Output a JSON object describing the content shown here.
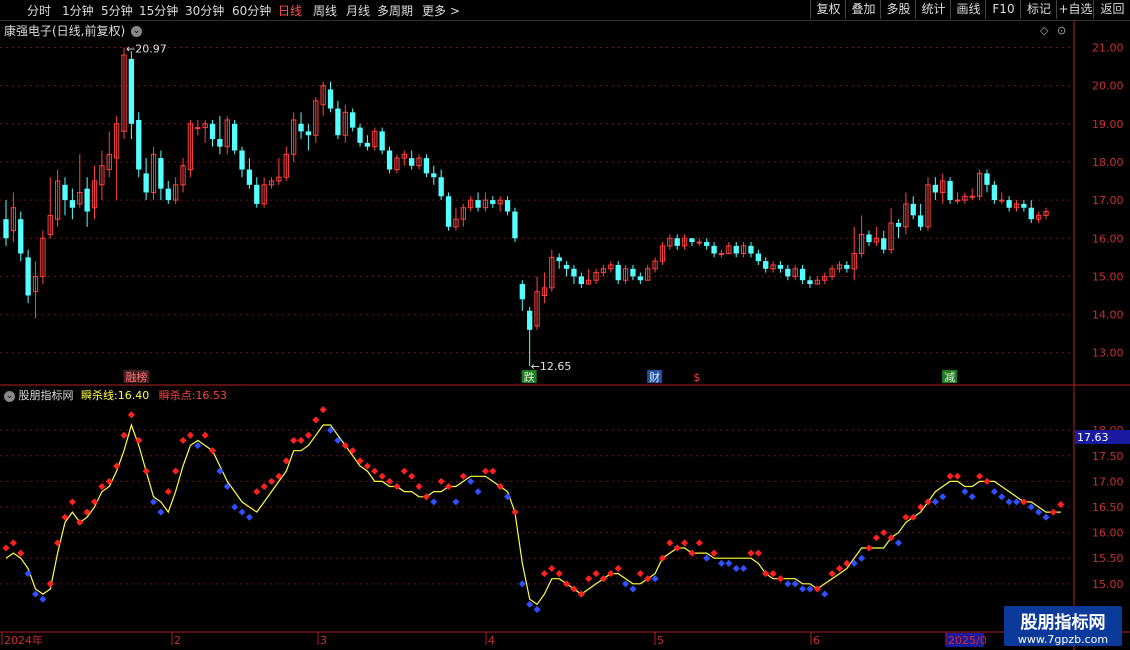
{
  "toolbar": {
    "periods": [
      "分时",
      "1分钟",
      "5分钟",
      "15分钟",
      "30分钟",
      "60分钟",
      "日线",
      "周线",
      "月线",
      "多周期",
      "更多 >"
    ],
    "active": "日线",
    "buttons": [
      "复权",
      "叠加",
      "多股",
      "统计",
      "画线",
      "F10",
      "标记",
      "+自选",
      "返回"
    ]
  },
  "price_panel": {
    "title": "康强电子(日线,前复权)"
  },
  "indicator_panel": {
    "name": "股朋指标网",
    "line_label": "瞬杀线:",
    "line_value": "16.40",
    "point_label": "瞬杀点:",
    "point_value": "16.53",
    "current_tag": "17.63"
  },
  "event_tags": [
    {
      "text": "融榜",
      "color": "#ff7070"
    },
    {
      "text": "跌",
      "color": "#e8e8e8"
    },
    {
      "text": "财",
      "color": "#e8e8e8"
    },
    {
      "text": "$",
      "color": "#ff4040"
    },
    {
      "text": "减",
      "color": "#e8e8e8"
    }
  ],
  "x_axis": {
    "labels": [
      "2024年",
      "2",
      "3",
      "4",
      "5",
      "6",
      "2025/0"
    ]
  },
  "watermark": {
    "title": "股朋指标网",
    "url": "www.7gpzb.com"
  },
  "colors": {
    "up": "#ff4040",
    "down": "#54ffff",
    "line": "#ffff40",
    "red_dot": "#ff2020",
    "blue_dot": "#3050ff"
  },
  "chart_data": [
    {
      "type": "candlestick",
      "title": "康强电子(日线,前复权)",
      "ylim": [
        12.6,
        21.3
      ],
      "y_ticks": [
        13.0,
        14.0,
        15.0,
        16.0,
        17.0,
        18.0,
        19.0,
        20.0,
        21.0
      ],
      "annotations": [
        {
          "text": "20.97",
          "value": 20.97
        },
        {
          "text": "12.65",
          "value": 12.65
        }
      ],
      "candles": [
        [
          16.5,
          16.0,
          17.0,
          15.8
        ],
        [
          16.2,
          16.8,
          17.2,
          15.9
        ],
        [
          16.5,
          15.6,
          16.7,
          15.4
        ],
        [
          15.5,
          14.5,
          15.7,
          14.3
        ],
        [
          14.6,
          15.0,
          15.4,
          13.9
        ],
        [
          15.0,
          16.0,
          16.2,
          14.8
        ],
        [
          16.1,
          16.6,
          17.6,
          16.0
        ],
        [
          16.5,
          17.5,
          17.8,
          16.3
        ],
        [
          17.4,
          17.0,
          17.6,
          16.6
        ],
        [
          17.0,
          16.8,
          17.3,
          16.5
        ],
        [
          16.9,
          17.2,
          18.2,
          16.8
        ],
        [
          17.3,
          16.7,
          17.6,
          16.3
        ],
        [
          16.8,
          17.5,
          17.9,
          16.5
        ],
        [
          17.4,
          17.9,
          18.3,
          17.0
        ],
        [
          17.8,
          18.2,
          18.8,
          17.6
        ],
        [
          18.1,
          19.0,
          19.2,
          17.0
        ],
        [
          18.8,
          20.8,
          21.0,
          18.6
        ],
        [
          20.7,
          19.0,
          20.9,
          18.6
        ],
        [
          19.1,
          17.8,
          19.3,
          17.6
        ],
        [
          17.7,
          17.2,
          18.1,
          17.0
        ],
        [
          17.2,
          18.2,
          18.4,
          17.0
        ],
        [
          18.1,
          17.3,
          18.3,
          17.0
        ],
        [
          17.3,
          17.0,
          17.5,
          16.9
        ],
        [
          17.0,
          17.4,
          17.6,
          16.9
        ],
        [
          17.4,
          17.9,
          18.1,
          17.2
        ],
        [
          17.8,
          19.0,
          19.1,
          17.6
        ],
        [
          18.9,
          18.9,
          19.1,
          18.7
        ],
        [
          18.9,
          19.0,
          19.1,
          18.5
        ],
        [
          19.0,
          18.6,
          19.1,
          18.4
        ],
        [
          18.6,
          18.4,
          19.2,
          18.2
        ],
        [
          18.4,
          19.1,
          19.2,
          18.2
        ],
        [
          19.0,
          18.3,
          19.1,
          18.2
        ],
        [
          18.3,
          17.8,
          18.4,
          17.6
        ],
        [
          17.8,
          17.4,
          18.1,
          17.3
        ],
        [
          17.4,
          16.9,
          17.6,
          16.8
        ],
        [
          16.9,
          17.4,
          17.6,
          16.8
        ],
        [
          17.4,
          17.5,
          17.6,
          17.3
        ],
        [
          17.5,
          17.6,
          18.1,
          17.4
        ],
        [
          17.6,
          18.2,
          18.4,
          17.5
        ],
        [
          18.2,
          19.1,
          19.3,
          18.0
        ],
        [
          19.0,
          18.8,
          19.3,
          18.6
        ],
        [
          18.8,
          18.7,
          19.0,
          18.3
        ],
        [
          18.7,
          19.6,
          19.7,
          18.5
        ],
        [
          19.5,
          20.0,
          20.1,
          19.2
        ],
        [
          19.9,
          19.4,
          20.1,
          19.3
        ],
        [
          19.4,
          18.7,
          19.6,
          18.6
        ],
        [
          18.7,
          19.3,
          19.5,
          18.5
        ],
        [
          19.3,
          18.9,
          19.4,
          18.8
        ],
        [
          18.9,
          18.5,
          19.0,
          18.4
        ],
        [
          18.5,
          18.4,
          18.7,
          18.3
        ],
        [
          18.4,
          18.8,
          18.9,
          18.3
        ],
        [
          18.8,
          18.3,
          18.9,
          18.2
        ],
        [
          18.3,
          17.8,
          18.4,
          17.7
        ],
        [
          17.8,
          18.1,
          18.2,
          17.7
        ],
        [
          18.1,
          18.2,
          18.3,
          17.9
        ],
        [
          18.1,
          17.9,
          18.3,
          17.8
        ],
        [
          17.9,
          18.1,
          18.2,
          17.8
        ],
        [
          18.1,
          17.7,
          18.2,
          17.6
        ],
        [
          17.7,
          17.6,
          17.9,
          17.4
        ],
        [
          17.6,
          17.1,
          17.8,
          17.0
        ],
        [
          17.1,
          16.3,
          17.2,
          16.2
        ],
        [
          16.3,
          16.5,
          16.8,
          16.2
        ],
        [
          16.5,
          16.8,
          16.9,
          16.3
        ],
        [
          16.8,
          17.0,
          17.1,
          16.7
        ],
        [
          17.0,
          16.8,
          17.2,
          16.7
        ],
        [
          16.8,
          17.0,
          17.2,
          16.7
        ],
        [
          17.0,
          16.9,
          17.1,
          16.8
        ],
        [
          16.9,
          17.0,
          17.1,
          16.7
        ],
        [
          17.0,
          16.7,
          17.1,
          16.6
        ],
        [
          16.7,
          16.0,
          16.8,
          15.9
        ],
        [
          14.8,
          14.4,
          14.9,
          14.1
        ],
        [
          14.1,
          13.6,
          14.2,
          12.65
        ],
        [
          13.7,
          14.6,
          15.0,
          13.6
        ],
        [
          14.5,
          14.7,
          15.1,
          14.3
        ],
        [
          14.7,
          15.5,
          15.7,
          14.6
        ],
        [
          15.5,
          15.4,
          15.6,
          15.2
        ],
        [
          15.3,
          15.2,
          15.4,
          15.0
        ],
        [
          15.2,
          15.0,
          15.3,
          14.8
        ],
        [
          15.0,
          14.8,
          15.1,
          14.7
        ],
        [
          14.8,
          14.9,
          15.2,
          14.8
        ],
        [
          14.9,
          15.1,
          15.2,
          14.8
        ],
        [
          15.1,
          15.2,
          15.3,
          15.0
        ],
        [
          15.2,
          15.3,
          15.4,
          15.1
        ],
        [
          15.3,
          14.9,
          15.4,
          14.8
        ],
        [
          14.9,
          15.2,
          15.3,
          14.8
        ],
        [
          15.2,
          15.0,
          15.3,
          14.9
        ],
        [
          15.0,
          14.9,
          15.1,
          14.8
        ],
        [
          14.9,
          15.2,
          15.3,
          14.9
        ],
        [
          15.2,
          15.4,
          15.5,
          15.1
        ],
        [
          15.4,
          15.8,
          15.9,
          15.3
        ],
        [
          15.8,
          16.0,
          16.1,
          15.7
        ],
        [
          16.0,
          15.8,
          16.1,
          15.7
        ],
        [
          15.8,
          16.0,
          16.1,
          15.7
        ],
        [
          16.0,
          15.9,
          16.0,
          15.8
        ],
        [
          15.9,
          15.9,
          16.0,
          15.8
        ],
        [
          15.9,
          15.8,
          16.0,
          15.7
        ],
        [
          15.8,
          15.6,
          15.9,
          15.5
        ],
        [
          15.6,
          15.6,
          15.7,
          15.5
        ],
        [
          15.6,
          15.8,
          15.9,
          15.6
        ],
        [
          15.8,
          15.6,
          15.9,
          15.5
        ],
        [
          15.6,
          15.8,
          15.9,
          15.5
        ],
        [
          15.8,
          15.6,
          15.9,
          15.5
        ],
        [
          15.6,
          15.4,
          15.7,
          15.3
        ],
        [
          15.4,
          15.2,
          15.5,
          15.1
        ],
        [
          15.2,
          15.3,
          15.4,
          15.1
        ],
        [
          15.3,
          15.2,
          15.4,
          15.1
        ],
        [
          15.2,
          15.0,
          15.3,
          14.9
        ],
        [
          15.0,
          15.2,
          15.3,
          14.9
        ],
        [
          15.2,
          14.9,
          15.3,
          14.8
        ],
        [
          14.9,
          14.8,
          15.0,
          14.7
        ],
        [
          14.8,
          14.9,
          15.0,
          14.8
        ],
        [
          14.9,
          15.0,
          15.1,
          14.8
        ],
        [
          15.0,
          15.2,
          15.3,
          14.9
        ],
        [
          15.2,
          15.3,
          15.4,
          15.1
        ],
        [
          15.3,
          15.2,
          15.4,
          15.1
        ],
        [
          15.2,
          15.6,
          16.3,
          14.9
        ],
        [
          15.6,
          16.1,
          16.6,
          15.5
        ],
        [
          16.1,
          15.9,
          16.2,
          15.8
        ],
        [
          15.9,
          16.0,
          16.3,
          15.8
        ],
        [
          16.0,
          15.7,
          16.2,
          15.6
        ],
        [
          15.7,
          16.4,
          16.8,
          15.6
        ],
        [
          16.4,
          16.3,
          16.5,
          16.0
        ],
        [
          16.3,
          16.9,
          17.2,
          16.1
        ],
        [
          16.9,
          16.6,
          17.1,
          16.5
        ],
        [
          16.6,
          16.3,
          16.9,
          16.2
        ],
        [
          16.3,
          17.4,
          17.6,
          16.2
        ],
        [
          17.4,
          17.2,
          17.6,
          17.0
        ],
        [
          17.2,
          17.5,
          17.7,
          16.9
        ],
        [
          17.5,
          17.0,
          17.6,
          16.9
        ],
        [
          17.0,
          17.0,
          17.2,
          16.9
        ],
        [
          17.0,
          17.1,
          17.2,
          16.9
        ],
        [
          17.1,
          17.1,
          17.3,
          17.0
        ],
        [
          17.1,
          17.7,
          17.8,
          17.0
        ],
        [
          17.7,
          17.4,
          17.8,
          17.2
        ],
        [
          17.4,
          17.0,
          17.5,
          16.9
        ],
        [
          17.0,
          17.0,
          17.2,
          16.9
        ],
        [
          17.0,
          16.8,
          17.1,
          16.7
        ],
        [
          16.8,
          16.9,
          17.0,
          16.7
        ],
        [
          16.9,
          16.8,
          17.0,
          16.7
        ],
        [
          16.8,
          16.5,
          17.0,
          16.4
        ],
        [
          16.5,
          16.6,
          16.7,
          16.4
        ],
        [
          16.6,
          16.7,
          16.8,
          16.5
        ]
      ]
    },
    {
      "type": "line",
      "title": "股朋指标网",
      "ylim": [
        14.45,
        18.55
      ],
      "y_ticks": [
        15.0,
        15.5,
        16.0,
        16.5,
        17.0,
        17.5,
        18.0
      ],
      "series": [
        {
          "name": "瞬杀线",
          "values": [
            15.5,
            15.6,
            15.5,
            15.3,
            14.9,
            14.8,
            14.9,
            15.6,
            16.2,
            16.4,
            16.2,
            16.3,
            16.5,
            16.8,
            16.9,
            17.2,
            17.6,
            18.1,
            17.7,
            17.2,
            16.7,
            16.6,
            16.4,
            16.8,
            17.3,
            17.7,
            17.8,
            17.7,
            17.6,
            17.3,
            17.0,
            16.8,
            16.6,
            16.5,
            16.4,
            16.6,
            16.8,
            17.0,
            17.2,
            17.6,
            17.6,
            17.7,
            17.9,
            18.1,
            18.1,
            17.9,
            17.7,
            17.5,
            17.3,
            17.2,
            17.0,
            17.0,
            16.9,
            16.9,
            16.8,
            16.8,
            16.7,
            16.7,
            16.8,
            16.8,
            16.9,
            16.9,
            17.0,
            17.1,
            17.1,
            17.1,
            17.0,
            16.9,
            16.8,
            16.4,
            15.4,
            14.7,
            14.6,
            14.8,
            15.1,
            15.1,
            15.0,
            14.9,
            14.8,
            14.9,
            15.0,
            15.1,
            15.2,
            15.2,
            15.1,
            15.0,
            15.0,
            15.1,
            15.2,
            15.5,
            15.6,
            15.7,
            15.7,
            15.6,
            15.6,
            15.6,
            15.5,
            15.5,
            15.5,
            15.5,
            15.5,
            15.5,
            15.4,
            15.2,
            15.1,
            15.1,
            15.1,
            15.1,
            15.0,
            15.0,
            14.9,
            15.0,
            15.1,
            15.2,
            15.3,
            15.5,
            15.7,
            15.7,
            15.7,
            15.7,
            15.9,
            16.0,
            16.2,
            16.3,
            16.4,
            16.6,
            16.8,
            16.9,
            17.0,
            17.0,
            16.9,
            16.9,
            17.0,
            17.0,
            17.0,
            16.9,
            16.8,
            16.7,
            16.6,
            16.6,
            16.5,
            16.4,
            16.4,
            16.4
          ]
        },
        {
          "name": "瞬杀点",
          "values": [
            15.7,
            15.8,
            15.6,
            15.2,
            14.8,
            14.7,
            15.0,
            15.8,
            16.3,
            16.6,
            16.2,
            16.4,
            16.6,
            16.9,
            17.0,
            17.3,
            17.9,
            18.3,
            17.8,
            17.2,
            16.6,
            16.4,
            16.8,
            17.2,
            17.8,
            17.9,
            17.7,
            17.9,
            17.6,
            17.2,
            16.9,
            16.5,
            16.4,
            16.3,
            16.8,
            16.9,
            17.0,
            17.1,
            17.4,
            17.8,
            17.8,
            17.9,
            18.2,
            18.4,
            18.0,
            17.8,
            17.7,
            17.6,
            17.4,
            17.3,
            17.2,
            17.1,
            17.0,
            16.9,
            17.2,
            17.1,
            16.9,
            16.7,
            16.6,
            17.0,
            16.9,
            16.6,
            17.1,
            17.0,
            16.8,
            17.2,
            17.2,
            16.9,
            16.7,
            16.4,
            15.0,
            14.6,
            14.5,
            15.2,
            15.3,
            15.2,
            15.0,
            14.9,
            14.8,
            15.1,
            15.2,
            15.1,
            15.2,
            15.3,
            15.0,
            14.9,
            15.2,
            15.1,
            15.1,
            15.5,
            15.8,
            15.7,
            15.8,
            15.6,
            15.8,
            15.5,
            15.6,
            15.4,
            15.4,
            15.3,
            15.3,
            15.6,
            15.6,
            15.2,
            15.2,
            15.1,
            15.0,
            15.0,
            14.9,
            14.9,
            14.9,
            14.8,
            15.2,
            15.3,
            15.4,
            15.4,
            15.5,
            15.7,
            15.9,
            16.0,
            15.9,
            15.8,
            16.3,
            16.3,
            16.5,
            16.6,
            16.6,
            16.7,
            17.1,
            17.1,
            16.8,
            16.7,
            17.1,
            17.0,
            16.8,
            16.7,
            16.6,
            16.6,
            16.6,
            16.5,
            16.4,
            16.3,
            16.4,
            16.55
          ]
        }
      ]
    }
  ]
}
